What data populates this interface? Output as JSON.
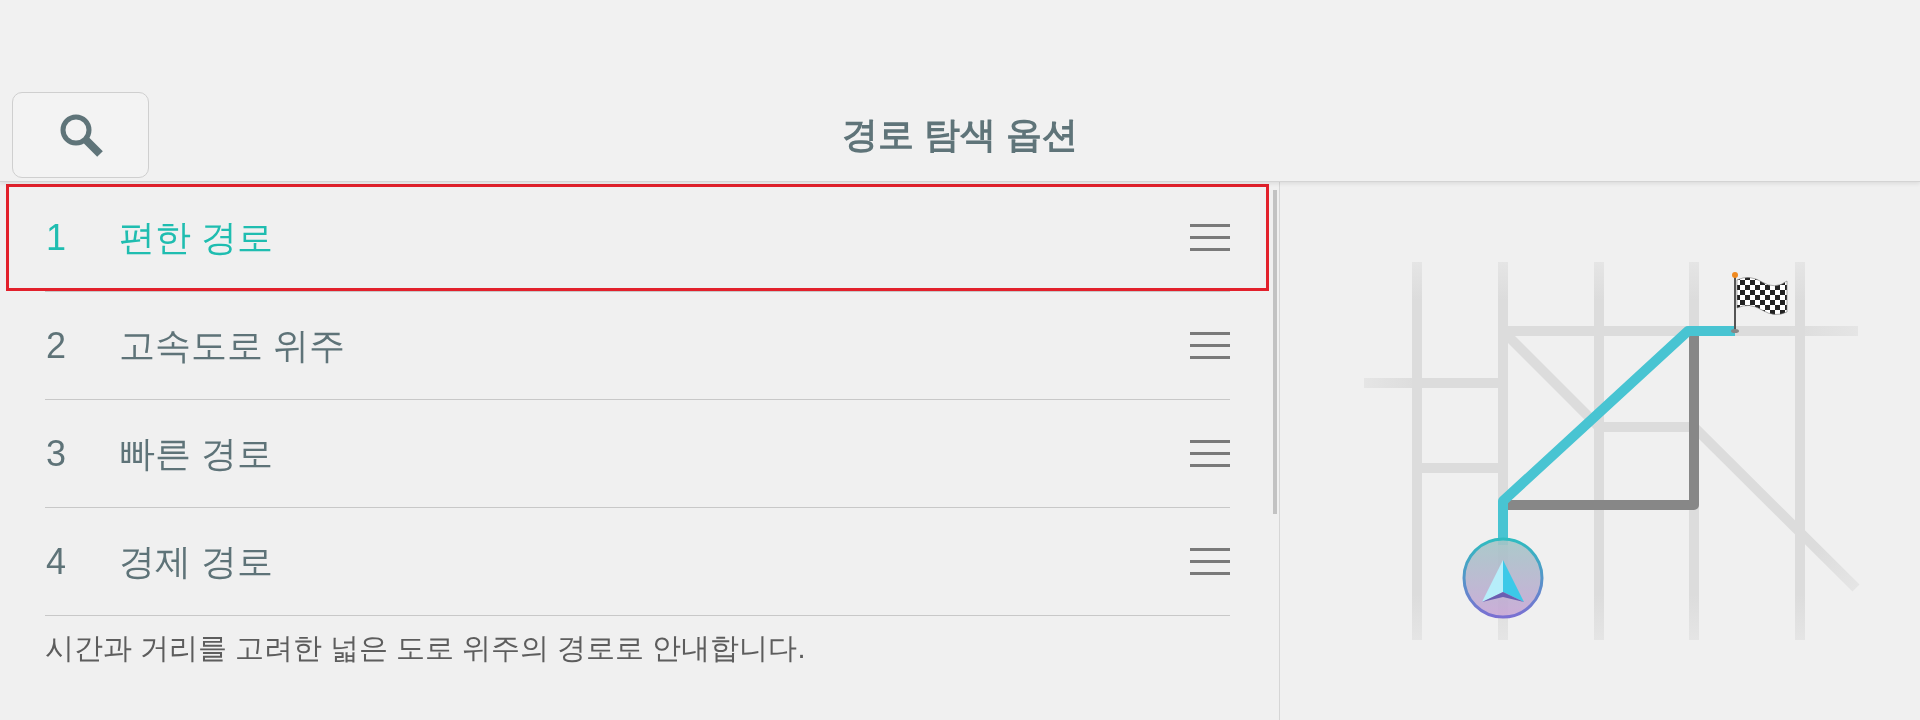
{
  "header": {
    "title": "경로 탐색 옵션"
  },
  "route_options": [
    {
      "number": "1",
      "label": "편한 경로",
      "selected": true
    },
    {
      "number": "2",
      "label": "고속도로 위주",
      "selected": false
    },
    {
      "number": "3",
      "label": "빠른 경로",
      "selected": false
    },
    {
      "number": "4",
      "label": "경제 경로",
      "selected": false
    }
  ],
  "description": "시간과 거리를 고려한 넓은 도로 위주의 경로로 안내합니다."
}
